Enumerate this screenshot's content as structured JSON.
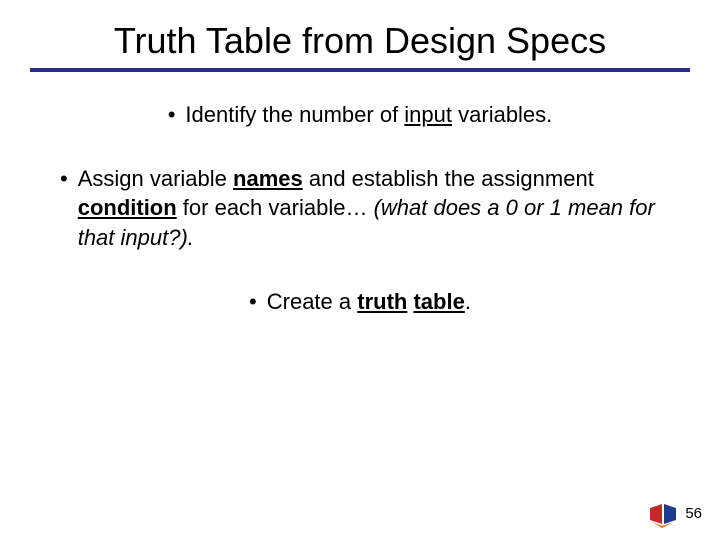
{
  "title": "Truth Table from Design Specs",
  "bullets": {
    "b1": {
      "pre": "Identify the number of ",
      "u1": "input",
      "post": " variables."
    },
    "b2": {
      "t1": " Assign variable ",
      "u1": "names",
      "t2": " and establish the assignment ",
      "u2": "condition",
      "t3": " for each variable… ",
      "it": "(what does a 0 or 1 mean for that input?)."
    },
    "b3": {
      "t1": "Create a ",
      "u1": "truth",
      "t2": " ",
      "u2": "table",
      "t3": "."
    }
  },
  "pageNumber": "56"
}
